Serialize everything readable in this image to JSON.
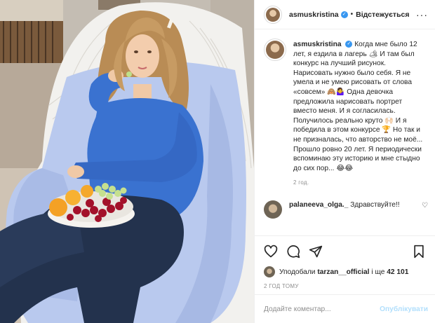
{
  "post": {
    "username": "asmuskristina",
    "follow_status": "Відстежується",
    "caption": "Когда мне было 12 лет, я ездила в лагерь 🏕 И там был конкурс на лучший рисунок. Нарисовать нужно было себя. Я не умела и не умею рисовать от слова «совсем» 🙈🤷‍♀️ Одна девочка предложила нарисовать портрет вместо меня. И я согласилась. Получилось реально круто 🙌🏻 И я победила в этом конкурсе 🏆 Но так и не призналась, что авторство не моё... Прошло ровно 20 лет. Я периодически вспоминаю эту историю и мне стыдно до сих пор... 😂😂",
    "caption_age": "2 год."
  },
  "comments": [
    {
      "username": "palaneeva_olga._",
      "text": "Здравствуйте!!",
      "sub": ""
    }
  ],
  "likes": {
    "prefix": "Уподобали",
    "user": "tarzan__official",
    "suffix": "і ще",
    "count": "42 101"
  },
  "time_ago": "2 ГОД ТОМУ",
  "add_comment": {
    "placeholder": "Додайте коментар...",
    "post_label": "Опублікувати"
  },
  "icons": {
    "verified": "verified-badge-icon",
    "like": "heart-icon",
    "comment": "comment-bubble-icon",
    "share": "paper-plane-icon",
    "save": "bookmark-icon",
    "more": "more-dots-icon"
  },
  "colors": {
    "verified_blue": "#3897f0",
    "post_button_disabled": "#b2dffc",
    "sweater_blue": "#3a72d0",
    "cushion_blue": "#b9c9ee"
  }
}
